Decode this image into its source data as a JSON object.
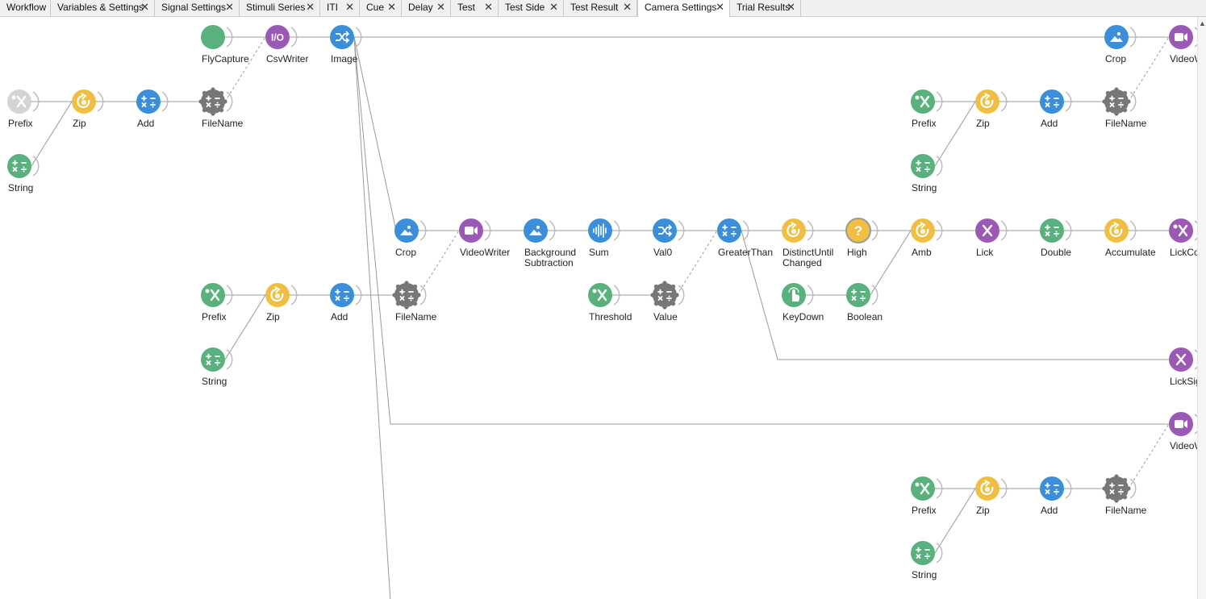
{
  "tabs": [
    {
      "label": "Workflow",
      "closable": false,
      "active": false
    },
    {
      "label": "Variables & Settings",
      "closable": true,
      "active": false
    },
    {
      "label": "Signal Settings",
      "closable": true,
      "active": false
    },
    {
      "label": "Stimuli Series",
      "closable": true,
      "active": false
    },
    {
      "label": "ITI",
      "closable": true,
      "active": false
    },
    {
      "label": "Cue",
      "closable": true,
      "active": false
    },
    {
      "label": "Delay",
      "closable": true,
      "active": false
    },
    {
      "label": "Test",
      "closable": true,
      "active": false
    },
    {
      "label": "Test Side",
      "closable": true,
      "active": false
    },
    {
      "label": "Test Result",
      "closable": true,
      "active": false
    },
    {
      "label": "Camera Settings",
      "closable": true,
      "active": true
    },
    {
      "label": "Trial Results",
      "closable": true,
      "active": false
    }
  ],
  "close_glyph": "✕",
  "colors": {
    "green": "#5bb17e",
    "purple": "#9b59b6",
    "blue": "#3a8fd8",
    "yellow": "#efbe43",
    "gray": "#777777",
    "disabled": "#d4d4d4",
    "wire": "#9a9a9a"
  },
  "nodes": [
    {
      "id": "flycapture",
      "label": "FlyCapture",
      "color": "green",
      "icon": "circle-source-icon"
    },
    {
      "id": "csvwriter",
      "label": "CsvWriter",
      "color": "purple",
      "icon": "io-icon"
    },
    {
      "id": "image",
      "label": "Image",
      "color": "blue",
      "icon": "shuffle-icon"
    },
    {
      "id": "crop-top",
      "label": "Crop",
      "color": "blue",
      "icon": "image-icon"
    },
    {
      "id": "videowriter-top",
      "label": "VideoW",
      "color": "purple",
      "icon": "video-icon"
    },
    {
      "id": "prefix-1",
      "label": "Prefix",
      "color": "disabled",
      "icon": "variable-x-icon"
    },
    {
      "id": "zip-1",
      "label": "Zip",
      "color": "yellow",
      "icon": "combinator-icon"
    },
    {
      "id": "add-1",
      "label": "Add",
      "color": "blue",
      "icon": "math-icon"
    },
    {
      "id": "filename-1",
      "label": "FileName",
      "color": "gray",
      "icon": "math-gear-icon"
    },
    {
      "id": "string-1",
      "label": "String",
      "color": "green",
      "icon": "math-icon"
    },
    {
      "id": "prefix-2",
      "label": "Prefix",
      "color": "green",
      "icon": "variable-x-icon"
    },
    {
      "id": "zip-2",
      "label": "Zip",
      "color": "yellow",
      "icon": "combinator-icon"
    },
    {
      "id": "add-2",
      "label": "Add",
      "color": "blue",
      "icon": "math-icon"
    },
    {
      "id": "filename-2",
      "label": "FileName",
      "color": "gray",
      "icon": "math-gear-icon"
    },
    {
      "id": "string-2",
      "label": "String",
      "color": "green",
      "icon": "math-icon"
    },
    {
      "id": "crop-mid",
      "label": "Crop",
      "color": "blue",
      "icon": "image-icon"
    },
    {
      "id": "videowriter-mid",
      "label": "VideoWriter",
      "color": "purple",
      "icon": "video-icon"
    },
    {
      "id": "bgsub",
      "label": "Background\nSubtraction",
      "color": "blue",
      "icon": "image-icon"
    },
    {
      "id": "sum",
      "label": "Sum",
      "color": "blue",
      "icon": "waveform-icon"
    },
    {
      "id": "val0",
      "label": "Val0",
      "color": "blue",
      "icon": "shuffle-icon"
    },
    {
      "id": "greaterthan",
      "label": "GreaterThan",
      "color": "blue",
      "icon": "math-icon"
    },
    {
      "id": "distinct",
      "label": "DistinctUntil\nChanged",
      "color": "yellow",
      "icon": "combinator-icon"
    },
    {
      "id": "high",
      "label": "High",
      "color": "yellow-q",
      "icon": "question-icon"
    },
    {
      "id": "amb",
      "label": "Amb",
      "color": "yellow",
      "icon": "combinator-icon"
    },
    {
      "id": "lick",
      "label": "Lick",
      "color": "purple",
      "icon": "x-icon"
    },
    {
      "id": "double",
      "label": "Double",
      "color": "green",
      "icon": "math-icon"
    },
    {
      "id": "accumulate",
      "label": "Accumulate",
      "color": "yellow",
      "icon": "combinator-icon"
    },
    {
      "id": "lickcount",
      "label": "LickCou",
      "color": "purple",
      "icon": "variable-x-icon"
    },
    {
      "id": "prefix-3",
      "label": "Prefix",
      "color": "green",
      "icon": "variable-x-icon"
    },
    {
      "id": "zip-3",
      "label": "Zip",
      "color": "yellow",
      "icon": "combinator-icon"
    },
    {
      "id": "add-3",
      "label": "Add",
      "color": "blue",
      "icon": "math-icon"
    },
    {
      "id": "filename-3",
      "label": "FileName",
      "color": "gray",
      "icon": "math-gear-icon"
    },
    {
      "id": "string-3",
      "label": "String",
      "color": "green",
      "icon": "math-icon"
    },
    {
      "id": "threshold",
      "label": "Threshold",
      "color": "green",
      "icon": "variable-x-icon"
    },
    {
      "id": "value",
      "label": "Value",
      "color": "gray",
      "icon": "math-gear-icon"
    },
    {
      "id": "keydown",
      "label": "KeyDown",
      "color": "green",
      "icon": "pointer-icon"
    },
    {
      "id": "boolean",
      "label": "Boolean",
      "color": "green",
      "icon": "math-icon"
    },
    {
      "id": "licksignal",
      "label": "LickSig",
      "color": "purple",
      "icon": "x-icon"
    },
    {
      "id": "videowriter-bot",
      "label": "VideoW",
      "color": "purple",
      "icon": "video-icon"
    },
    {
      "id": "prefix-4",
      "label": "Prefix",
      "color": "green",
      "icon": "variable-x-icon"
    },
    {
      "id": "zip-4",
      "label": "Zip",
      "color": "yellow",
      "icon": "combinator-icon"
    },
    {
      "id": "add-4",
      "label": "Add",
      "color": "blue",
      "icon": "math-icon"
    },
    {
      "id": "filename-4",
      "label": "FileName",
      "color": "gray",
      "icon": "math-gear-icon"
    },
    {
      "id": "string-4",
      "label": "String",
      "color": "green",
      "icon": "math-icon"
    }
  ],
  "edges": [
    [
      "flycapture",
      "csvwriter"
    ],
    [
      "csvwriter",
      "image"
    ],
    [
      "image",
      "videowriter-top"
    ],
    [
      "prefix-1",
      "zip-1"
    ],
    [
      "zip-1",
      "add-1"
    ],
    [
      "add-1",
      "filename-1"
    ],
    [
      "string-1",
      "zip-1"
    ],
    [
      "filename-1",
      "csvwriter",
      "dashed"
    ],
    [
      "prefix-2",
      "zip-2"
    ],
    [
      "zip-2",
      "add-2"
    ],
    [
      "add-2",
      "filename-2"
    ],
    [
      "string-2",
      "zip-2"
    ],
    [
      "filename-2",
      "videowriter-top",
      "dashed"
    ],
    [
      "image",
      "crop-mid"
    ],
    [
      "crop-mid",
      "videowriter-mid"
    ],
    [
      "videowriter-mid",
      "bgsub"
    ],
    [
      "bgsub",
      "sum"
    ],
    [
      "sum",
      "val0"
    ],
    [
      "val0",
      "greaterthan"
    ],
    [
      "greaterthan",
      "distinct"
    ],
    [
      "distinct",
      "high"
    ],
    [
      "high",
      "amb"
    ],
    [
      "amb",
      "lick"
    ],
    [
      "lick",
      "double"
    ],
    [
      "double",
      "accumulate"
    ],
    [
      "accumulate",
      "lickcount"
    ],
    [
      "prefix-3",
      "zip-3"
    ],
    [
      "zip-3",
      "add-3"
    ],
    [
      "add-3",
      "filename-3"
    ],
    [
      "string-3",
      "zip-3"
    ],
    [
      "filename-3",
      "videowriter-mid",
      "dashed"
    ],
    [
      "threshold",
      "value"
    ],
    [
      "value",
      "greaterthan",
      "dashed"
    ],
    [
      "keydown",
      "boolean"
    ],
    [
      "boolean",
      "amb"
    ],
    [
      "greaterthan",
      "licksignal"
    ],
    [
      "image",
      "videowriter-bot"
    ],
    [
      "prefix-4",
      "zip-4"
    ],
    [
      "zip-4",
      "add-4"
    ],
    [
      "add-4",
      "filename-4"
    ],
    [
      "string-4",
      "zip-4"
    ],
    [
      "filename-4",
      "videowriter-bot",
      "dashed"
    ],
    [
      "image",
      "offscreen-bottom"
    ]
  ]
}
